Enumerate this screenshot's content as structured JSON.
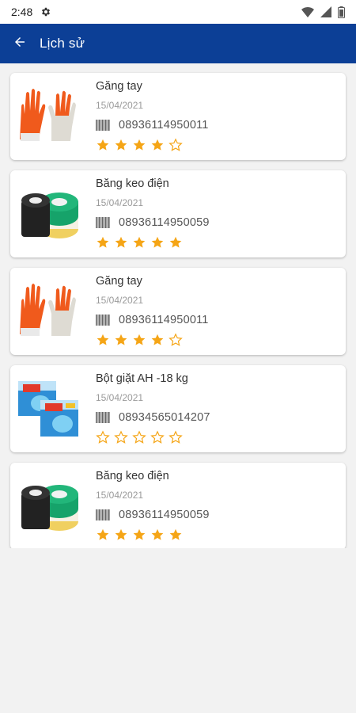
{
  "status_bar": {
    "time": "2:48",
    "icons": [
      "gear-icon",
      "wifi-icon",
      "signal-icon",
      "battery-icon"
    ]
  },
  "app_bar": {
    "back_icon": "arrow-left-icon",
    "title": "Lịch sử"
  },
  "colors": {
    "app_bar": "#0c3f96",
    "star": "#f5a516",
    "background": "#f2f2f2"
  },
  "history": [
    {
      "name": "Găng tay",
      "date": "15/04/2021",
      "barcode": "08936114950011",
      "rating": 4,
      "image": "gloves-image"
    },
    {
      "name": "Băng keo điện",
      "date": "15/04/2021",
      "barcode": "08936114950059",
      "rating": 5,
      "image": "electrical-tape-image"
    },
    {
      "name": "Găng tay",
      "date": "15/04/2021",
      "barcode": "08936114950011",
      "rating": 4,
      "image": "gloves-image"
    },
    {
      "name": "Bột giặt AH -18 kg",
      "date": "15/04/2021",
      "barcode": "08934565014207",
      "rating": 0,
      "image": "detergent-box-image"
    },
    {
      "name": "Băng keo điện",
      "date": "15/04/2021",
      "barcode": "08936114950059",
      "rating": 5,
      "image": "electrical-tape-image"
    }
  ]
}
